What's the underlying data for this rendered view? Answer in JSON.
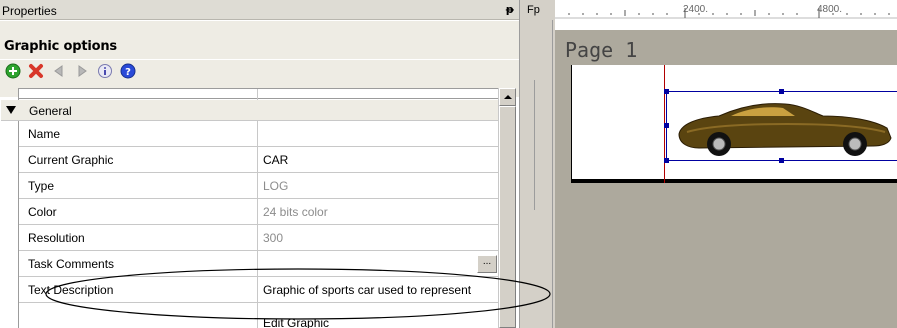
{
  "properties_panel": {
    "title": "Properties",
    "pin": "ᵽ",
    "section": "Graphic options",
    "toolbar": [
      {
        "name": "add-icon"
      },
      {
        "name": "delete-icon"
      },
      {
        "name": "previous-icon"
      },
      {
        "name": "next-icon"
      },
      {
        "name": "info-icon"
      },
      {
        "name": "help-icon"
      }
    ],
    "group": "General",
    "rows": [
      {
        "name": "Name",
        "value": "",
        "grey": false
      },
      {
        "name": "Current Graphic",
        "value": "CAR",
        "grey": false
      },
      {
        "name": "Type",
        "value": "LOG",
        "grey": true
      },
      {
        "name": "Color",
        "value": "24 bits color",
        "grey": true
      },
      {
        "name": "Resolution",
        "value": "300",
        "grey": true
      },
      {
        "name": "Task Comments",
        "value": "",
        "grey": false,
        "ellipsis": "..."
      },
      {
        "name": "Text Description",
        "value": "Graphic of sports car used to represent",
        "grey": false
      }
    ],
    "edit_graphic": "Edit Graphic"
  },
  "preview": {
    "fp_label": "Fp",
    "ruler_labels": [
      "2400.",
      "4800."
    ],
    "page_title": "Page 1",
    "image_icon": "sports-car-icon"
  },
  "colors": {
    "selection": "#0000a0",
    "margin_line": "#b00000",
    "canvas_bg": "#ada99d",
    "toolbar_add": "#2ea32e",
    "toolbar_delete": "#d8372a",
    "toolbar_help": "#2a4ad8"
  }
}
